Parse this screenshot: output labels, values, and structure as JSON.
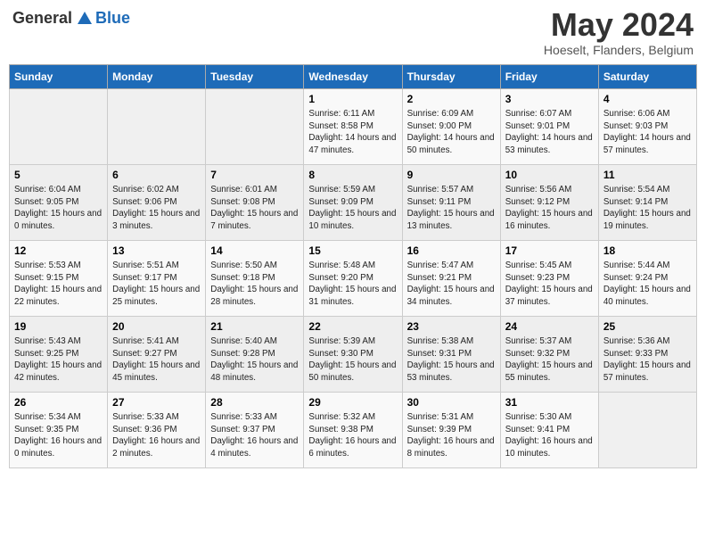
{
  "header": {
    "logo_general": "General",
    "logo_blue": "Blue",
    "month": "May 2024",
    "location": "Hoeselt, Flanders, Belgium"
  },
  "weekdays": [
    "Sunday",
    "Monday",
    "Tuesday",
    "Wednesday",
    "Thursday",
    "Friday",
    "Saturday"
  ],
  "weeks": [
    [
      {
        "day": "",
        "sunrise": "",
        "sunset": "",
        "daylight": ""
      },
      {
        "day": "",
        "sunrise": "",
        "sunset": "",
        "daylight": ""
      },
      {
        "day": "",
        "sunrise": "",
        "sunset": "",
        "daylight": ""
      },
      {
        "day": "1",
        "sunrise": "Sunrise: 6:11 AM",
        "sunset": "Sunset: 8:58 PM",
        "daylight": "Daylight: 14 hours and 47 minutes."
      },
      {
        "day": "2",
        "sunrise": "Sunrise: 6:09 AM",
        "sunset": "Sunset: 9:00 PM",
        "daylight": "Daylight: 14 hours and 50 minutes."
      },
      {
        "day": "3",
        "sunrise": "Sunrise: 6:07 AM",
        "sunset": "Sunset: 9:01 PM",
        "daylight": "Daylight: 14 hours and 53 minutes."
      },
      {
        "day": "4",
        "sunrise": "Sunrise: 6:06 AM",
        "sunset": "Sunset: 9:03 PM",
        "daylight": "Daylight: 14 hours and 57 minutes."
      }
    ],
    [
      {
        "day": "5",
        "sunrise": "Sunrise: 6:04 AM",
        "sunset": "Sunset: 9:05 PM",
        "daylight": "Daylight: 15 hours and 0 minutes."
      },
      {
        "day": "6",
        "sunrise": "Sunrise: 6:02 AM",
        "sunset": "Sunset: 9:06 PM",
        "daylight": "Daylight: 15 hours and 3 minutes."
      },
      {
        "day": "7",
        "sunrise": "Sunrise: 6:01 AM",
        "sunset": "Sunset: 9:08 PM",
        "daylight": "Daylight: 15 hours and 7 minutes."
      },
      {
        "day": "8",
        "sunrise": "Sunrise: 5:59 AM",
        "sunset": "Sunset: 9:09 PM",
        "daylight": "Daylight: 15 hours and 10 minutes."
      },
      {
        "day": "9",
        "sunrise": "Sunrise: 5:57 AM",
        "sunset": "Sunset: 9:11 PM",
        "daylight": "Daylight: 15 hours and 13 minutes."
      },
      {
        "day": "10",
        "sunrise": "Sunrise: 5:56 AM",
        "sunset": "Sunset: 9:12 PM",
        "daylight": "Daylight: 15 hours and 16 minutes."
      },
      {
        "day": "11",
        "sunrise": "Sunrise: 5:54 AM",
        "sunset": "Sunset: 9:14 PM",
        "daylight": "Daylight: 15 hours and 19 minutes."
      }
    ],
    [
      {
        "day": "12",
        "sunrise": "Sunrise: 5:53 AM",
        "sunset": "Sunset: 9:15 PM",
        "daylight": "Daylight: 15 hours and 22 minutes."
      },
      {
        "day": "13",
        "sunrise": "Sunrise: 5:51 AM",
        "sunset": "Sunset: 9:17 PM",
        "daylight": "Daylight: 15 hours and 25 minutes."
      },
      {
        "day": "14",
        "sunrise": "Sunrise: 5:50 AM",
        "sunset": "Sunset: 9:18 PM",
        "daylight": "Daylight: 15 hours and 28 minutes."
      },
      {
        "day": "15",
        "sunrise": "Sunrise: 5:48 AM",
        "sunset": "Sunset: 9:20 PM",
        "daylight": "Daylight: 15 hours and 31 minutes."
      },
      {
        "day": "16",
        "sunrise": "Sunrise: 5:47 AM",
        "sunset": "Sunset: 9:21 PM",
        "daylight": "Daylight: 15 hours and 34 minutes."
      },
      {
        "day": "17",
        "sunrise": "Sunrise: 5:45 AM",
        "sunset": "Sunset: 9:23 PM",
        "daylight": "Daylight: 15 hours and 37 minutes."
      },
      {
        "day": "18",
        "sunrise": "Sunrise: 5:44 AM",
        "sunset": "Sunset: 9:24 PM",
        "daylight": "Daylight: 15 hours and 40 minutes."
      }
    ],
    [
      {
        "day": "19",
        "sunrise": "Sunrise: 5:43 AM",
        "sunset": "Sunset: 9:25 PM",
        "daylight": "Daylight: 15 hours and 42 minutes."
      },
      {
        "day": "20",
        "sunrise": "Sunrise: 5:41 AM",
        "sunset": "Sunset: 9:27 PM",
        "daylight": "Daylight: 15 hours and 45 minutes."
      },
      {
        "day": "21",
        "sunrise": "Sunrise: 5:40 AM",
        "sunset": "Sunset: 9:28 PM",
        "daylight": "Daylight: 15 hours and 48 minutes."
      },
      {
        "day": "22",
        "sunrise": "Sunrise: 5:39 AM",
        "sunset": "Sunset: 9:30 PM",
        "daylight": "Daylight: 15 hours and 50 minutes."
      },
      {
        "day": "23",
        "sunrise": "Sunrise: 5:38 AM",
        "sunset": "Sunset: 9:31 PM",
        "daylight": "Daylight: 15 hours and 53 minutes."
      },
      {
        "day": "24",
        "sunrise": "Sunrise: 5:37 AM",
        "sunset": "Sunset: 9:32 PM",
        "daylight": "Daylight: 15 hours and 55 minutes."
      },
      {
        "day": "25",
        "sunrise": "Sunrise: 5:36 AM",
        "sunset": "Sunset: 9:33 PM",
        "daylight": "Daylight: 15 hours and 57 minutes."
      }
    ],
    [
      {
        "day": "26",
        "sunrise": "Sunrise: 5:34 AM",
        "sunset": "Sunset: 9:35 PM",
        "daylight": "Daylight: 16 hours and 0 minutes."
      },
      {
        "day": "27",
        "sunrise": "Sunrise: 5:33 AM",
        "sunset": "Sunset: 9:36 PM",
        "daylight": "Daylight: 16 hours and 2 minutes."
      },
      {
        "day": "28",
        "sunrise": "Sunrise: 5:33 AM",
        "sunset": "Sunset: 9:37 PM",
        "daylight": "Daylight: 16 hours and 4 minutes."
      },
      {
        "day": "29",
        "sunrise": "Sunrise: 5:32 AM",
        "sunset": "Sunset: 9:38 PM",
        "daylight": "Daylight: 16 hours and 6 minutes."
      },
      {
        "day": "30",
        "sunrise": "Sunrise: 5:31 AM",
        "sunset": "Sunset: 9:39 PM",
        "daylight": "Daylight: 16 hours and 8 minutes."
      },
      {
        "day": "31",
        "sunrise": "Sunrise: 5:30 AM",
        "sunset": "Sunset: 9:41 PM",
        "daylight": "Daylight: 16 hours and 10 minutes."
      },
      {
        "day": "",
        "sunrise": "",
        "sunset": "",
        "daylight": ""
      }
    ]
  ]
}
